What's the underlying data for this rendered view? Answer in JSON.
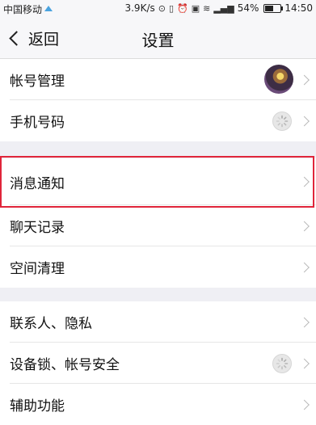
{
  "status_bar": {
    "carrier": "中国移动",
    "speed": "3.9K/s",
    "battery": "54%",
    "time": "14:50",
    "battery_level": 0.54
  },
  "nav": {
    "back_label": "返回",
    "title": "设置"
  },
  "settings": {
    "group1": [
      {
        "label": "帐号管理"
      },
      {
        "label": "手机号码"
      }
    ],
    "group2": [
      {
        "label": "消息通知"
      },
      {
        "label": "聊天记录"
      },
      {
        "label": "空间清理"
      }
    ],
    "group3": [
      {
        "label": "联系人、隐私"
      },
      {
        "label": "设备锁、帐号安全"
      },
      {
        "label": "辅助功能"
      }
    ]
  },
  "colors": {
    "highlight_border": "#e0253a",
    "background": "#efeff4"
  }
}
